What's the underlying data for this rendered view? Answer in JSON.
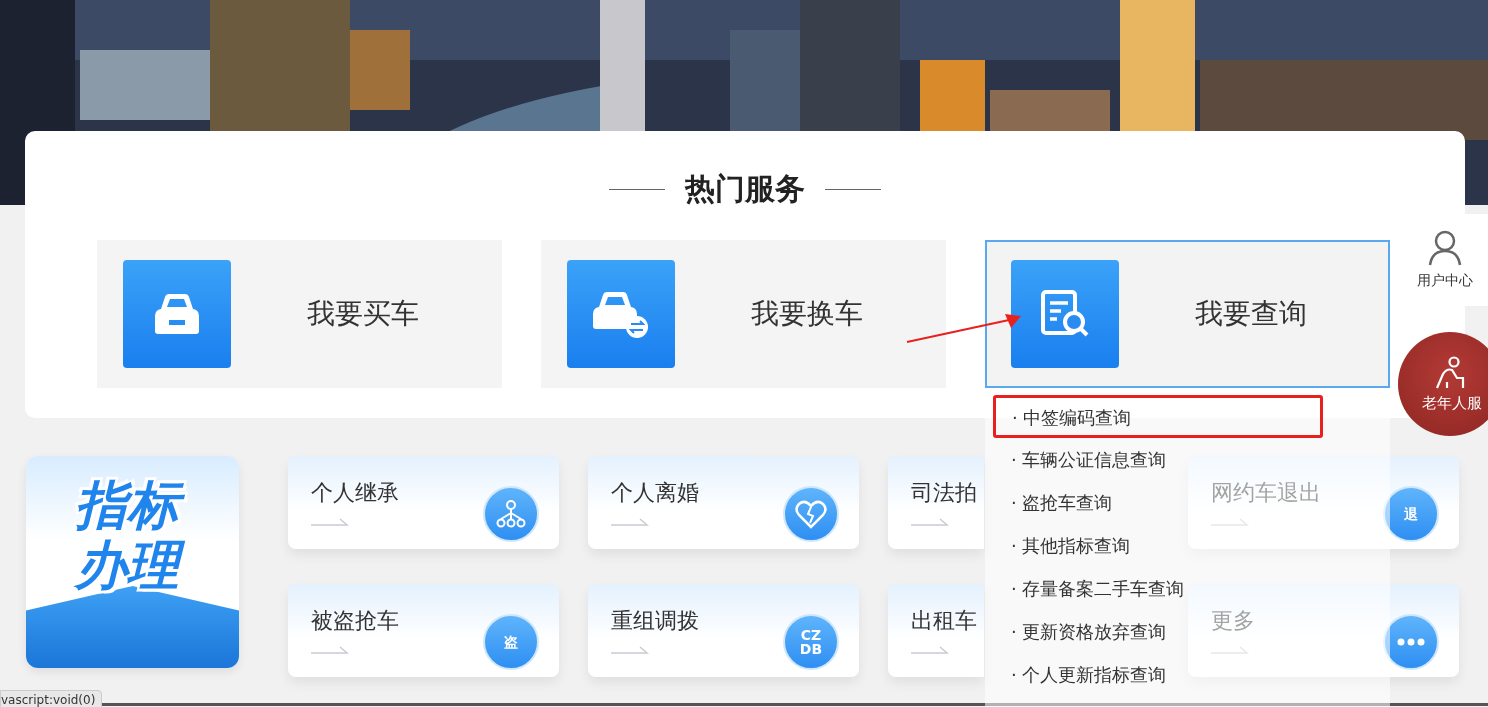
{
  "section_title": "热门服务",
  "services": [
    {
      "label": "我要买车",
      "kind": "buy",
      "selected": false
    },
    {
      "label": "我要换车",
      "kind": "swap",
      "selected": false
    },
    {
      "label": "我要查询",
      "kind": "query",
      "selected": true
    }
  ],
  "query_menu": [
    {
      "label": "· 中签编码查询",
      "selected": true
    },
    {
      "label": "· 车辆公证信息查询",
      "selected": false
    },
    {
      "label": "· 盗抢车查询",
      "selected": false
    },
    {
      "label": "· 其他指标查询",
      "selected": false
    },
    {
      "label": "· 存量备案二手车查询",
      "selected": false
    },
    {
      "label": "· 更新资格放弃查询",
      "selected": false
    },
    {
      "label": "· 个人更新指标查询",
      "selected": false
    }
  ],
  "feature_tile": {
    "label": "指标办理"
  },
  "cards": [
    {
      "label": "个人继承",
      "kind": "tree"
    },
    {
      "label": "个人离婚",
      "kind": "heart"
    },
    {
      "label": "司法拍",
      "kind": "hidden"
    },
    {
      "label": "网约车退出",
      "kind": "badge",
      "icon_text": "退"
    },
    {
      "label": "被盗抢车",
      "kind": "badge",
      "icon_text": "盗"
    },
    {
      "label": "重组调拨",
      "kind": "badge",
      "icon_text": "CZ DB"
    },
    {
      "label": "出租车",
      "kind": "hidden"
    },
    {
      "label": "更多",
      "kind": "dots"
    }
  ],
  "side": {
    "user_center": "用户中心",
    "elder_service": "老年人服"
  },
  "status_tooltip": "vascript:void(0)"
}
